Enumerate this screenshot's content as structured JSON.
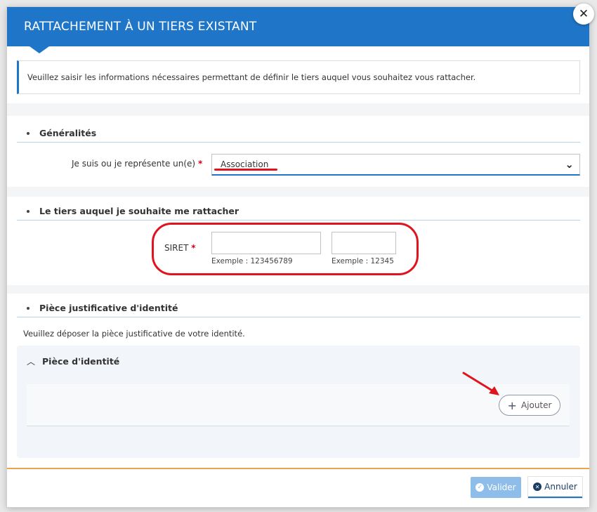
{
  "modal": {
    "title": "RATTACHEMENT À UN TIERS EXISTANT",
    "info": "Veuillez saisir les informations nécessaires permettant de définir le tiers auquel vous souhaitez vous rattacher.",
    "close_icon": "close-icon"
  },
  "sections": {
    "generalites": {
      "title": "Généralités",
      "type_label": "Je suis ou je représente un(e)",
      "required_mark": "*",
      "type_value": "Association"
    },
    "tiers": {
      "title": "Le tiers auquel je souhaite me rattacher",
      "siret_label": "SIRET",
      "required_mark": "*",
      "siren_value": "",
      "nic_value": "",
      "siren_hint": "Exemple : 123456789",
      "nic_hint": "Exemple : 12345"
    },
    "piece": {
      "title": "Pièce justificative d'identité",
      "text": "Veuillez déposer la pièce justificative de votre identité.",
      "panel_title": "Pièce d'identité",
      "add_label": "Ajouter"
    }
  },
  "footer": {
    "validate_label": "Valider",
    "cancel_label": "Annuler"
  },
  "colors": {
    "header": "#1f76c9",
    "annotation": "#e0141e",
    "validate": "#8dbde8",
    "cancel_text": "#1a3d63"
  }
}
